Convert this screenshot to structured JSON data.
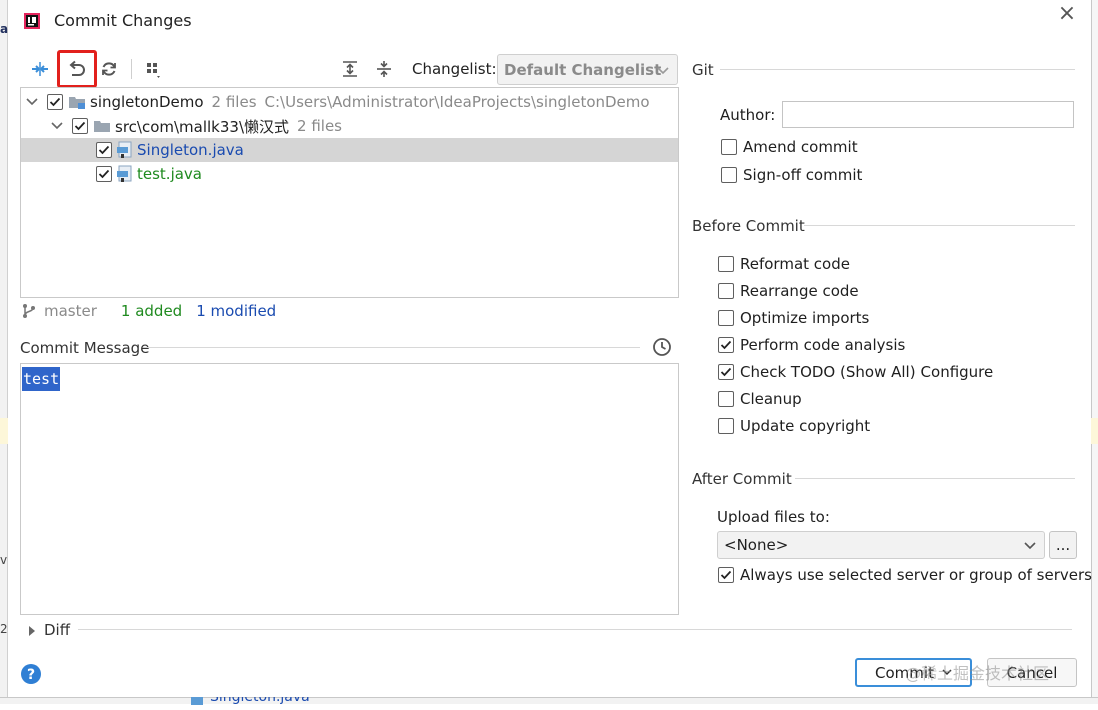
{
  "window": {
    "title": "Commit Changes"
  },
  "toolbar": {
    "changelist_label": "Changelist:",
    "changelist_value": "Default Changelist"
  },
  "tree": {
    "root": {
      "name": "singletonDemo",
      "count": "2 files",
      "path": "C:\\Users\\Administrator\\IdeaProjects\\singletonDemo"
    },
    "folder": {
      "name": "src\\com\\mallk33\\懒汉式",
      "count": "2 files"
    },
    "files": [
      {
        "name": "Singleton.java",
        "color": "#1a4bb0"
      },
      {
        "name": "test.java",
        "color": "#1f8a1f"
      }
    ]
  },
  "status": {
    "branch": "master",
    "added": "1 added",
    "modified": "1 modified"
  },
  "commit_message": {
    "label": "Commit Message",
    "value": "test"
  },
  "git": {
    "section_label": "Git",
    "author_label": "Author:",
    "author_value": "",
    "amend": {
      "label": "Amend commit",
      "checked": false
    },
    "signoff": {
      "label": "Sign-off commit",
      "checked": false
    }
  },
  "before_commit": {
    "section_label": "Before Commit",
    "options": [
      {
        "label": "Reformat code",
        "checked": false
      },
      {
        "label": "Rearrange code",
        "checked": false
      },
      {
        "label": "Optimize imports",
        "checked": false
      },
      {
        "label": "Perform code analysis",
        "checked": true
      },
      {
        "label": "Check TODO (Show All)",
        "checked": true
      },
      {
        "label": "Cleanup",
        "checked": false
      },
      {
        "label": "Update copyright",
        "checked": false
      }
    ],
    "configure_link": "Configure"
  },
  "after_commit": {
    "section_label": "After Commit",
    "upload_label": "Upload files to:",
    "upload_value": "<None>",
    "browse_label": "...",
    "always_use": {
      "label": "Always use selected server or group of servers",
      "checked": true
    }
  },
  "diff": {
    "label": "Diff"
  },
  "buttons": {
    "commit": "Commit",
    "cancel": "Cancel"
  },
  "background": {
    "left_snippets": [
      "a",
      "v",
      "2"
    ],
    "bottom_file": "Singleton.java"
  },
  "watermark": "@稀土掘金技术社区",
  "colors": {
    "accent": "#3a8ed9",
    "link": "#2470b3",
    "added": "#1f8a1f",
    "modified": "#1a4bb0",
    "highlight": "#e2201c",
    "selection": "#2f65ca"
  }
}
